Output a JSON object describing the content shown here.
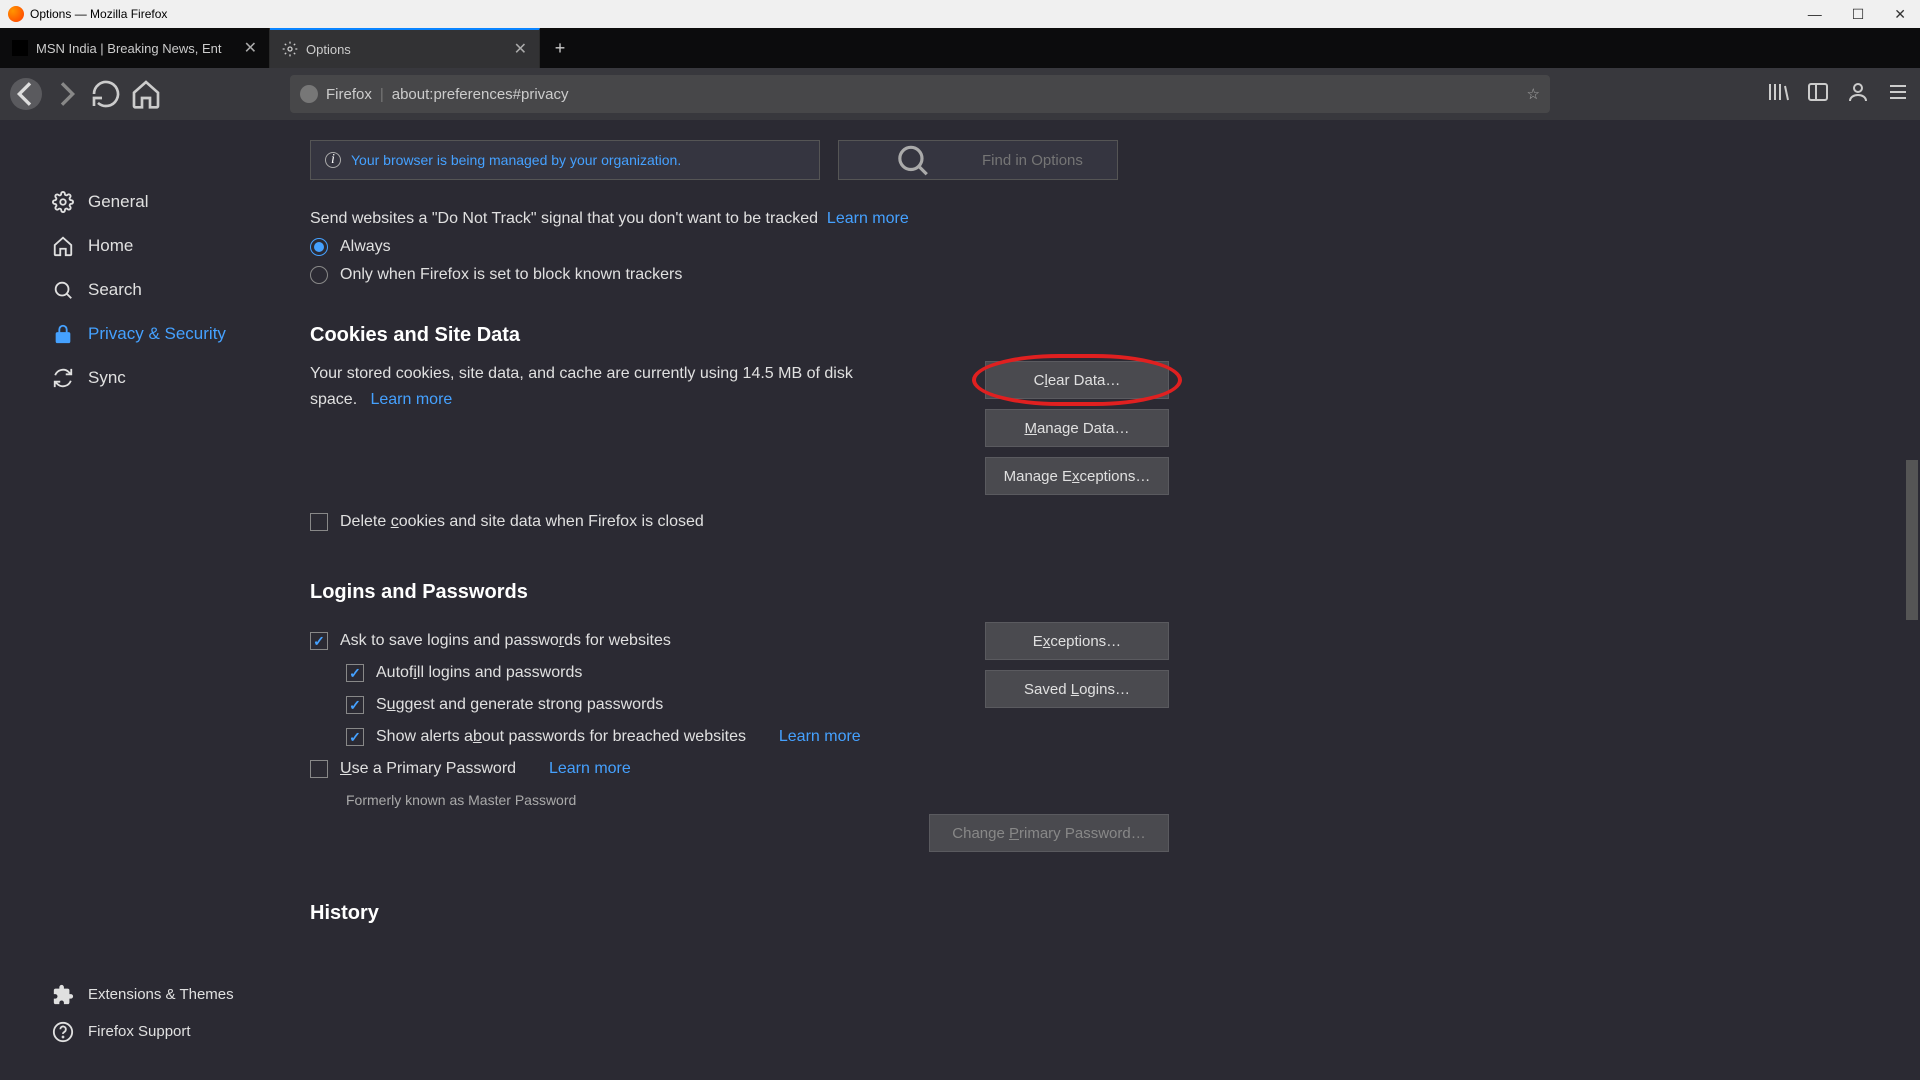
{
  "window": {
    "title": "Options — Mozilla Firefox"
  },
  "tabs": {
    "items": [
      {
        "label": "MSN India | Breaking News, Ent"
      },
      {
        "label": "Options"
      }
    ]
  },
  "urlbar": {
    "identity": "Firefox",
    "url": "about:preferences#privacy"
  },
  "searchbox": {
    "placeholder": "Find in Options"
  },
  "managed_message": "Your browser is being managed by your organization.",
  "sidebar": {
    "general": "General",
    "home": "Home",
    "search": "Search",
    "privacy": "Privacy & Security",
    "sync": "Sync",
    "extensions": "Extensions & Themes",
    "support": "Firefox Support"
  },
  "dnt": {
    "text": "Send websites a \"Do Not Track\" signal that you don't want to be tracked",
    "learn": "Learn more",
    "always": "Always",
    "only_block": "Only when Firefox is set to block known trackers"
  },
  "cookies": {
    "title": "Cookies and Site Data",
    "desc1": "Your stored cookies, site data, and cache are currently using 14.5 MB of disk space.",
    "learn": "Learn more",
    "delete_close": "Delete cookies and site data when Firefox is closed",
    "clear": "Clear Data…",
    "manage": "Manage Data…",
    "exceptions": "Manage Exceptions…"
  },
  "logins": {
    "title": "Logins and Passwords",
    "ask_save": "Ask to save logins and passwords for websites",
    "autofill": "Autofill logins and passwords",
    "suggest": "Suggest and generate strong passwords",
    "alerts": "Show alerts about passwords for breached websites",
    "alerts_learn": "Learn more",
    "primary": "Use a Primary Password",
    "primary_learn": "Learn more",
    "former": "Formerly known as Master Password",
    "exceptions_btn": "Exceptions…",
    "saved_btn": "Saved Logins…",
    "change_btn": "Change Primary Password…"
  },
  "history": {
    "title": "History"
  }
}
